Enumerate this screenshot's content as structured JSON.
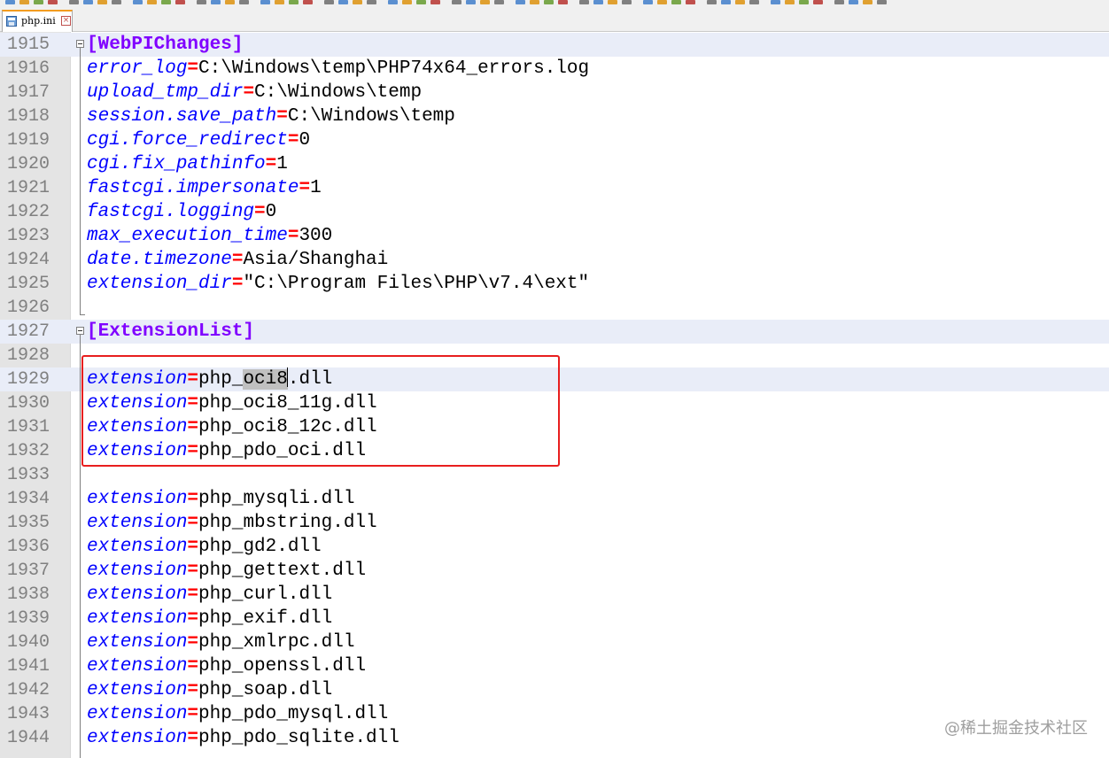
{
  "tab": {
    "label": "php.ini"
  },
  "lines": [
    {
      "n": "1915",
      "section": "[WebPIChanges]"
    },
    {
      "n": "1916",
      "key": "error_log",
      "value": "C:\\Windows\\temp\\PHP74x64_errors.log"
    },
    {
      "n": "1917",
      "key": "upload_tmp_dir",
      "value": "C:\\Windows\\temp"
    },
    {
      "n": "1918",
      "key": "session.save_path",
      "value": "C:\\Windows\\temp"
    },
    {
      "n": "1919",
      "key": "cgi.force_redirect",
      "value": "0"
    },
    {
      "n": "1920",
      "key": "cgi.fix_pathinfo",
      "value": "1"
    },
    {
      "n": "1921",
      "key": "fastcgi.impersonate",
      "value": "1"
    },
    {
      "n": "1922",
      "key": "fastcgi.logging",
      "value": "0"
    },
    {
      "n": "1923",
      "key": "max_execution_time",
      "value": "300"
    },
    {
      "n": "1924",
      "key": "date.timezone",
      "value": "Asia/Shanghai"
    },
    {
      "n": "1925",
      "key": "extension_dir",
      "value": "\"C:\\Program Files\\PHP\\v7.4\\ext\""
    },
    {
      "n": "1926"
    },
    {
      "n": "1927",
      "section": "[ExtensionList]"
    },
    {
      "n": "1928"
    },
    {
      "n": "1929",
      "key": "extension",
      "value_before": "php_",
      "value_selected": "oci8",
      "value_after": ".dll",
      "current": true
    },
    {
      "n": "1930",
      "key": "extension",
      "value": "php_oci8_11g.dll"
    },
    {
      "n": "1931",
      "key": "extension",
      "value": "php_oci8_12c.dll"
    },
    {
      "n": "1932",
      "key": "extension",
      "value": "php_pdo_oci.dll"
    },
    {
      "n": "1933"
    },
    {
      "n": "1934",
      "key": "extension",
      "value": "php_mysqli.dll"
    },
    {
      "n": "1935",
      "key": "extension",
      "value": "php_mbstring.dll"
    },
    {
      "n": "1936",
      "key": "extension",
      "value": "php_gd2.dll"
    },
    {
      "n": "1937",
      "key": "extension",
      "value": "php_gettext.dll"
    },
    {
      "n": "1938",
      "key": "extension",
      "value": "php_curl.dll"
    },
    {
      "n": "1939",
      "key": "extension",
      "value": "php_exif.dll"
    },
    {
      "n": "1940",
      "key": "extension",
      "value": "php_xmlrpc.dll"
    },
    {
      "n": "1941",
      "key": "extension",
      "value": "php_openssl.dll"
    },
    {
      "n": "1942",
      "key": "extension",
      "value": "php_soap.dll"
    },
    {
      "n": "1943",
      "key": "extension",
      "value": "php_pdo_mysql.dll"
    },
    {
      "n": "1944",
      "key": "extension",
      "value": "php_pdo_sqlite.dll"
    }
  ],
  "watermark": "@稀土掘金技术社区",
  "colors": {
    "key": "#0000ff",
    "operator": "#ff0000",
    "section": "#8000ff",
    "annotation": "#e81e1e",
    "tab_accent": "#f39c1f"
  },
  "icons": [
    "file-icon",
    "close-icon",
    "fold-minus-icon"
  ]
}
